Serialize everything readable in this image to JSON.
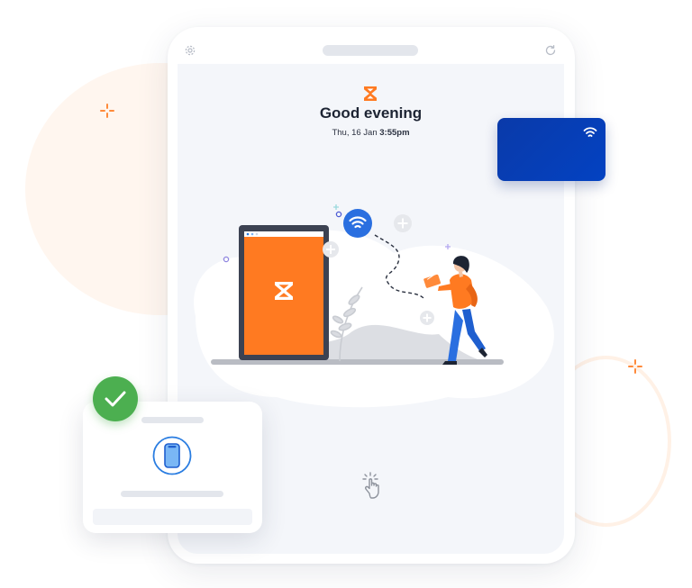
{
  "screen": {
    "greeting": "Good evening",
    "date": "Thu, 16 Jan",
    "time": "3:55pm"
  },
  "icons": {
    "settings": "gear-icon",
    "sync": "refresh-icon",
    "logo": "hourglass-logo-icon",
    "nfc": "contactless-icon",
    "tap": "tap-hand-icon",
    "phone": "phone-icon",
    "check": "check-icon"
  },
  "colors": {
    "brand_orange": "#ff7a21",
    "nfc_card_blue": "#0a3aa9",
    "check_green": "#4caf50",
    "phone_blue": "#2a7de1"
  }
}
